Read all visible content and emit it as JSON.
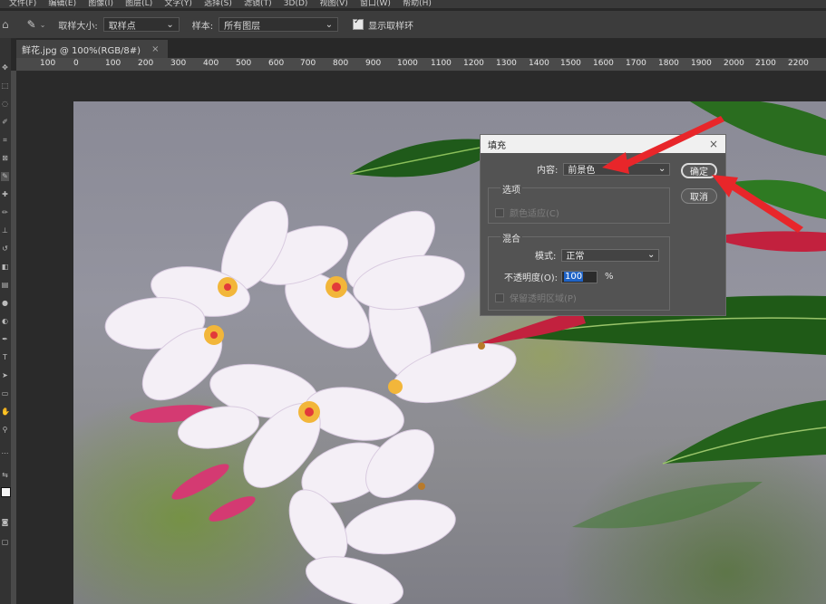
{
  "menubar": [
    "文件(F)",
    "编辑(E)",
    "图像(I)",
    "图层(L)",
    "文字(Y)",
    "选择(S)",
    "滤镜(T)",
    "3D(D)",
    "视图(V)",
    "窗口(W)",
    "帮助(H)"
  ],
  "options": {
    "sample_size_label": "取样大小:",
    "sample_size_value": "取样点",
    "sample_label": "样本:",
    "sample_value": "所有图层",
    "show_ring_label": "显示取样环"
  },
  "tab": {
    "title": "鲜花.jpg @ 100%(RGB/8#)",
    "close": "×"
  },
  "ruler": [
    "100",
    "0",
    "100",
    "200",
    "300",
    "400",
    "500",
    "600",
    "700",
    "800",
    "900",
    "1000",
    "1100",
    "1200",
    "1300",
    "1400",
    "1500",
    "1600",
    "1700",
    "1800",
    "1900",
    "2000",
    "2100",
    "2200"
  ],
  "dialog": {
    "title": "填充",
    "close": "×",
    "content_label": "内容:",
    "content_value": "前景色",
    "ok": "确定",
    "cancel": "取消",
    "options_group": "选项",
    "color_adapt": "颜色适应(C)",
    "blend_group": "混合",
    "mode_label": "模式:",
    "mode_value": "正常",
    "opacity_label": "不透明度(O):",
    "opacity_value": "100",
    "opacity_unit": "%",
    "preserve_label": "保留透明区域(P)"
  },
  "colors": {
    "arrow": "#e8262a",
    "accent_selection": "#1f63c6"
  }
}
